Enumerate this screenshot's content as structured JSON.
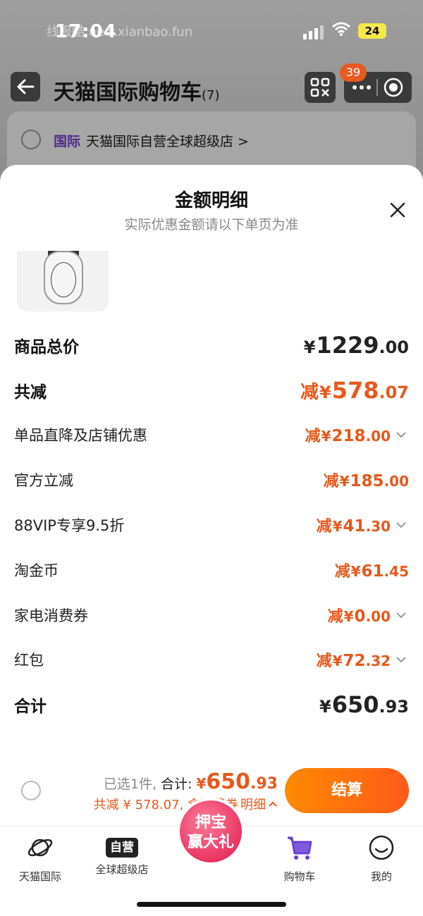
{
  "status_bar": {
    "time": "17:04",
    "watermark": "线报酷 new.xianbao.fun",
    "battery": "24"
  },
  "nav": {
    "title": "天猫国际购物车",
    "count": "(7)",
    "message_badge": "39",
    "icons": [
      "back-arrow-icon",
      "scan-icon",
      "more-icon",
      "record-icon"
    ]
  },
  "store": {
    "tag": "国际",
    "name": "天猫国际自营全球超级店 >"
  },
  "sheet": {
    "title": "金额明细",
    "subtitle": "实际优惠金额请以下单页为准"
  },
  "rows": [
    {
      "label": "商品总价",
      "prefix": "",
      "yen": "¥",
      "int": "1229",
      "dec": ".00",
      "expandable": false
    },
    {
      "label": "共减",
      "prefix": "减",
      "yen": "¥",
      "int": "578",
      "dec": ".07",
      "expandable": false
    },
    {
      "label": "单品直降及店铺优惠",
      "prefix": "减",
      "yen": "¥",
      "int": "218",
      "dec": ".00",
      "expandable": true
    },
    {
      "label": "官方立减",
      "prefix": "减",
      "yen": "¥",
      "int": "185",
      "dec": ".00",
      "expandable": false
    },
    {
      "label": "88VIP专享9.5折",
      "prefix": "减",
      "yen": "¥",
      "int": "41",
      "dec": ".30",
      "expandable": true
    },
    {
      "label": "淘金币",
      "prefix": "减",
      "yen": "¥",
      "int": "61",
      "dec": ".45",
      "expandable": false
    },
    {
      "label": "家电消费券",
      "prefix": "减",
      "yen": "¥",
      "int": "0",
      "dec": ".00",
      "expandable": true
    },
    {
      "label": "红包",
      "prefix": "减",
      "yen": "¥",
      "int": "72",
      "dec": ".32",
      "expandable": true
    },
    {
      "label": "合计",
      "prefix": "",
      "yen": "¥",
      "int": "650",
      "dec": ".93",
      "expandable": false
    }
  ],
  "checkout": {
    "selected": "已选1件,",
    "total_label": "合计:",
    "yen": "¥",
    "total_int": "650",
    "total_dec": ".93",
    "summary": "共减 ¥ 578.07, 含消费券",
    "detail_link": "明细",
    "pay_button": "结算"
  },
  "promo": {
    "line1": "押宝",
    "line2": "赢大礼"
  },
  "tabs": [
    {
      "label": "天猫国际",
      "icon": "planet-icon"
    },
    {
      "label": "全球超级店",
      "icon": "ziying-icon",
      "icon_text": "自营"
    },
    {
      "label": "购物车",
      "icon": "cart-icon"
    },
    {
      "label": "我的",
      "icon": "smile-icon"
    }
  ],
  "colors": {
    "accent": "#e8581b",
    "pay_gradient_start": "#ff8a00",
    "pay_gradient_end": "#ff5a1a",
    "cart_active": "#6a3fd6"
  }
}
